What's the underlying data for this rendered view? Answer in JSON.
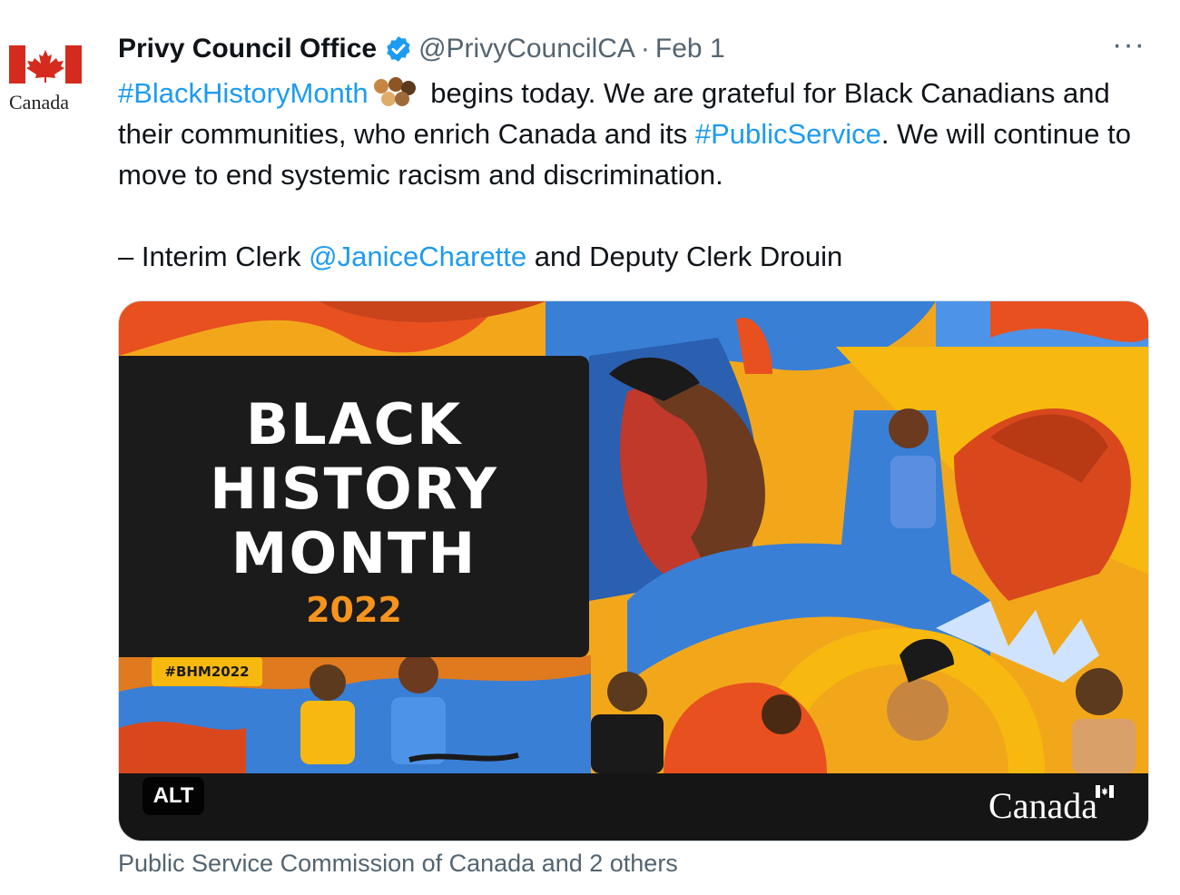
{
  "avatar": {
    "wordmark": "Canada"
  },
  "tweet": {
    "author_name": "Privy Council Office",
    "handle": "@PrivyCouncilCA",
    "separator": "·",
    "date": "Feb 1",
    "more_icon": "···",
    "text": {
      "hashtag_bhm": "#BlackHistoryMonth",
      "part1": " begins today. We are grateful for Black Canadians and their communities, who enrich Canada and its ",
      "hashtag_ps": "#PublicService",
      "part2": ". We will continue to move to end systemic racism and discrimination.",
      "sign_prefix": "– Interim Clerk ",
      "mention": "@JaniceCharette",
      "sign_suffix": " and Deputy Clerk Drouin"
    }
  },
  "media": {
    "title_line1": "BLACK",
    "title_line2": "HISTORY",
    "title_line3": "MONTH",
    "year": "2022",
    "hashtag": "#BHM2022",
    "alt_label": "ALT",
    "wordmark": "Canada"
  },
  "tagged_users": "Public Service Commission of Canada and 2 others",
  "colors": {
    "link": "#1d9bf0",
    "secondary_text": "#536471",
    "verified": "#1d9bf0",
    "canada_red": "#d52b1e"
  },
  "icons": [
    "canada-flag-icon",
    "verified-badge-icon",
    "more-icon",
    "raised-fist-emoji-icon"
  ]
}
